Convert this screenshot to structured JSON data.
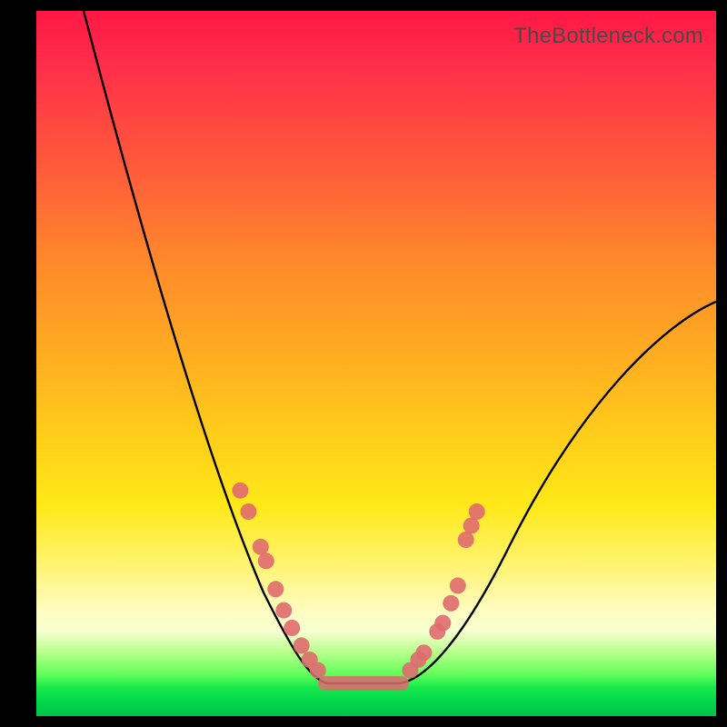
{
  "watermark": "TheBottleneck.com",
  "colors": {
    "frame": "#000000",
    "curve": "#000000",
    "marker": "#e06a6f",
    "gradient_stops": [
      "#ff1744",
      "#ff5a3a",
      "#ffb020",
      "#ffe818",
      "#fffcc0",
      "#63ff5a",
      "#00c24a"
    ]
  },
  "chart_data": {
    "type": "line",
    "title": "",
    "xlabel": "",
    "ylabel": "",
    "xlim": [
      0,
      100
    ],
    "ylim": [
      0,
      100
    ],
    "curve": {
      "left_start_x": 7,
      "left_start_y": 100,
      "valley_flat_x": [
        42,
        54
      ],
      "valley_y": 5,
      "right_end_x": 100,
      "right_end_y": 58
    },
    "markers_left": [
      {
        "x": 30,
        "y": 32
      },
      {
        "x": 31.2,
        "y": 29
      },
      {
        "x": 33,
        "y": 24
      },
      {
        "x": 33.8,
        "y": 22
      },
      {
        "x": 35.2,
        "y": 18
      },
      {
        "x": 36.4,
        "y": 15
      },
      {
        "x": 37.6,
        "y": 12.5
      },
      {
        "x": 39,
        "y": 10
      },
      {
        "x": 40.2,
        "y": 8
      },
      {
        "x": 41.4,
        "y": 6.5
      }
    ],
    "markers_right": [
      {
        "x": 55,
        "y": 6.5
      },
      {
        "x": 56.2,
        "y": 8
      },
      {
        "x": 57,
        "y": 9
      },
      {
        "x": 59,
        "y": 12
      },
      {
        "x": 59.8,
        "y": 13.2
      },
      {
        "x": 61,
        "y": 16
      },
      {
        "x": 62,
        "y": 18.5
      },
      {
        "x": 63.2,
        "y": 25
      },
      {
        "x": 64,
        "y": 27
      },
      {
        "x": 64.8,
        "y": 29
      }
    ],
    "valley_band": {
      "x0": 42,
      "x1": 54,
      "y": 5,
      "height": 2
    }
  }
}
